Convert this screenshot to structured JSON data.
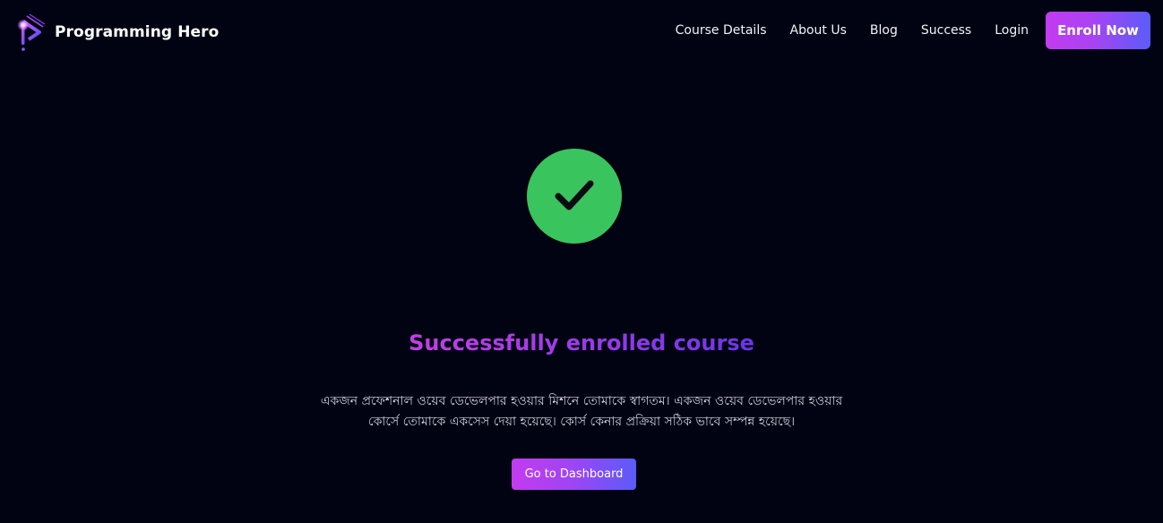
{
  "brand": {
    "name": "Programming Hero",
    "logo_icon": "programming-hero-logo-icon"
  },
  "nav": {
    "items": [
      {
        "label": "Course Details"
      },
      {
        "label": "About Us"
      },
      {
        "label": "Blog"
      },
      {
        "label": "Success"
      },
      {
        "label": "Login"
      }
    ],
    "cta_label": "Enroll Now"
  },
  "main": {
    "status_icon": "check-circle-icon",
    "title": "Successfully enrolled course",
    "description": "একজন প্রফেশনাল ওয়েব ডেভেলপার হওয়ার মিশনে তোমাকে স্বাগতম। একজন ওয়েব ডেভেলপার হওয়ার কোর্সে তোমাকে একসেস দেয়া হয়েছে। কোর্স কেনার প্রক্রিয়া সঠিক ভাবে সম্পন্ন হয়েছে।",
    "button_label": "Go to Dashboard"
  },
  "colors": {
    "background": "#020312",
    "accent_start": "#c43bf0",
    "accent_end": "#5a5cf9",
    "success": "#3ac45e"
  }
}
